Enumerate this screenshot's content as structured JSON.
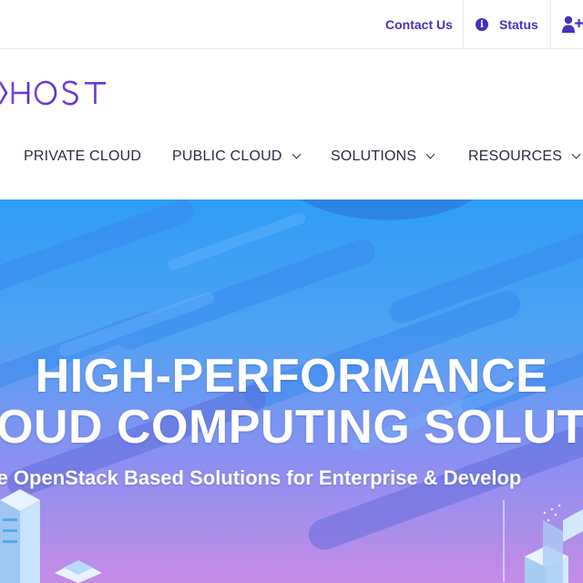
{
  "topbar": {
    "contact_label": "Contact Us",
    "status_label": "Status",
    "info_icon_glyph": "i",
    "accent_color": "#4a2fbd"
  },
  "logo": {
    "text": "XHOST"
  },
  "nav": {
    "items": [
      {
        "label": "PRIVATE CLOUD",
        "has_dropdown": false
      },
      {
        "label": "PUBLIC CLOUD",
        "has_dropdown": true
      },
      {
        "label": "SOLUTIONS",
        "has_dropdown": true
      },
      {
        "label": "RESOURCES",
        "has_dropdown": true
      }
    ]
  },
  "hero": {
    "title_line1": "HIGH-PERFORMANCE",
    "title_line2": "OUD COMPUTING SOLUTIO",
    "subtitle": "re OpenStack Based Solutions for Enterprise & Develop",
    "gradient_top": "#2f9df6",
    "gradient_bottom": "#c48ce6"
  }
}
